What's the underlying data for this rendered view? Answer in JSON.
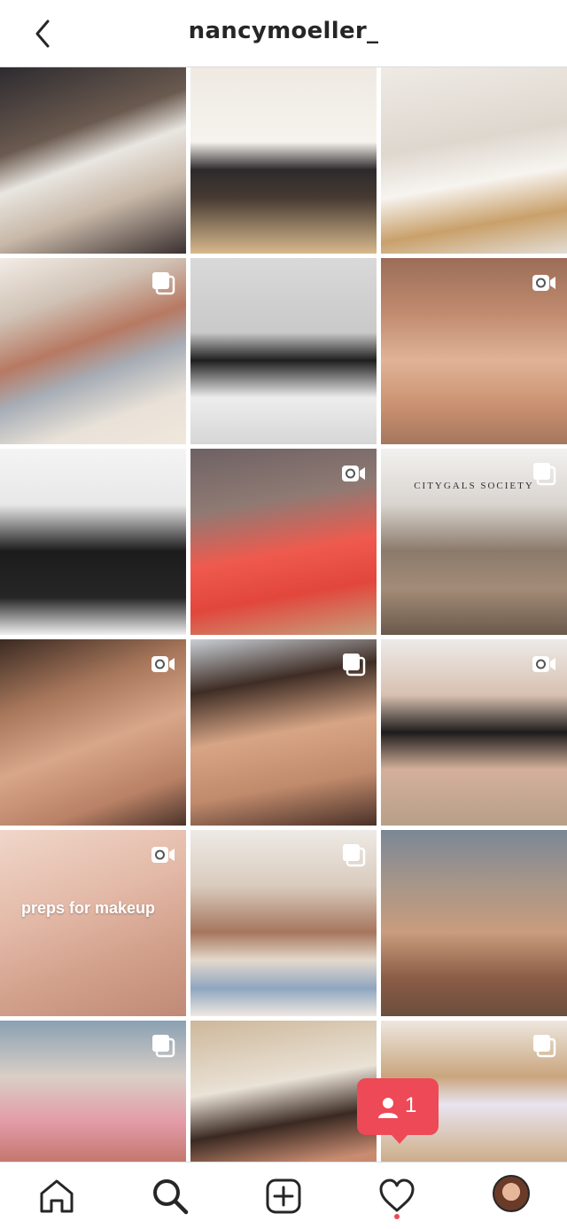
{
  "header": {
    "username": "nancymoeller_"
  },
  "grid": {
    "tiles": [
      {
        "badge": "none",
        "caption": "",
        "logo": ""
      },
      {
        "badge": "none",
        "caption": "",
        "logo": ""
      },
      {
        "badge": "none",
        "caption": "",
        "logo": ""
      },
      {
        "badge": "carousel",
        "caption": "",
        "logo": ""
      },
      {
        "badge": "none",
        "caption": "",
        "logo": ""
      },
      {
        "badge": "video",
        "caption": "",
        "logo": ""
      },
      {
        "badge": "none",
        "caption": "",
        "logo": ""
      },
      {
        "badge": "video",
        "caption": "",
        "logo": ""
      },
      {
        "badge": "carousel",
        "caption": "",
        "logo": "CITYGALS SOCIETY"
      },
      {
        "badge": "video",
        "caption": "",
        "logo": ""
      },
      {
        "badge": "carousel",
        "caption": "",
        "logo": ""
      },
      {
        "badge": "video",
        "caption": "",
        "logo": ""
      },
      {
        "badge": "video",
        "caption": "preps for makeup",
        "logo": ""
      },
      {
        "badge": "carousel",
        "caption": "",
        "logo": ""
      },
      {
        "badge": "none",
        "caption": "",
        "logo": ""
      },
      {
        "badge": "carousel",
        "caption": "",
        "logo": ""
      },
      {
        "badge": "none",
        "caption": "",
        "logo": ""
      },
      {
        "badge": "carousel",
        "caption": "",
        "logo": ""
      }
    ]
  },
  "notification": {
    "count": "1"
  },
  "tabbar": {
    "items": [
      "home",
      "search",
      "new-post",
      "activity",
      "profile"
    ],
    "activity_dot_color": "#ed4956"
  },
  "colors": {
    "accent": "#ed4956",
    "text": "#262626",
    "divider": "#dbdbdb"
  }
}
